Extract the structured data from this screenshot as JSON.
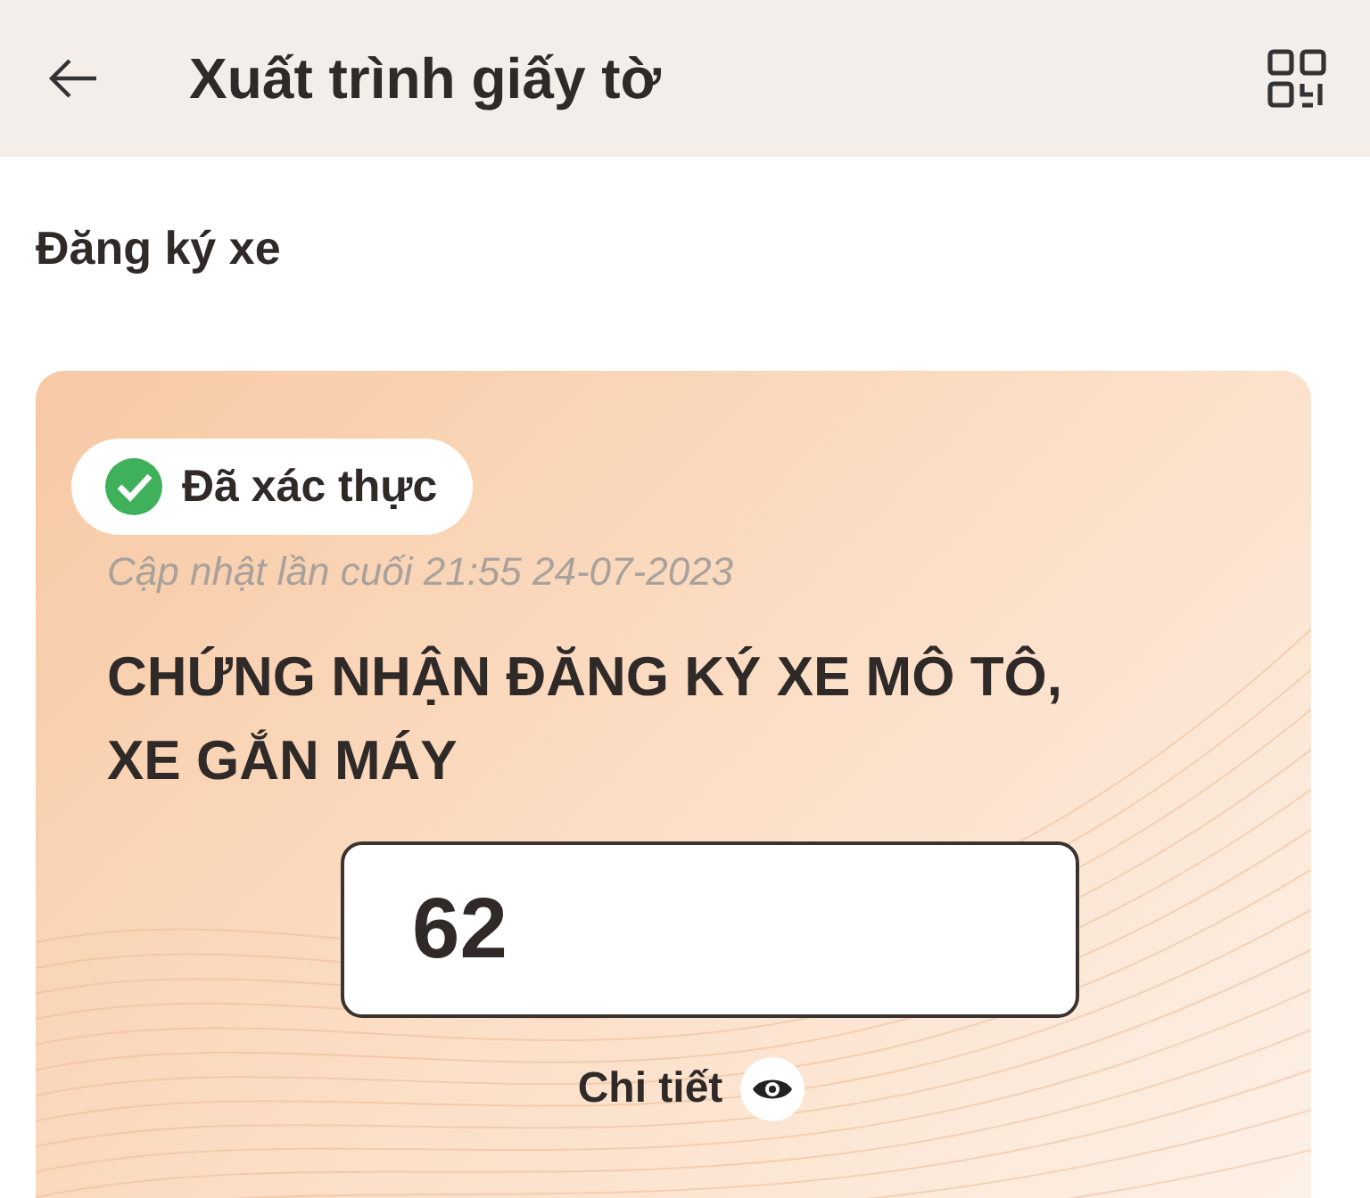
{
  "header": {
    "title": "Xuất trình giấy tờ"
  },
  "section": {
    "title": "Đăng ký xe"
  },
  "card": {
    "status": {
      "label": "Đã xác thực",
      "verified": true
    },
    "updated": "Cập nhật lần cuối 21:55 24-07-2023",
    "title": "CHỨNG NHẬN ĐĂNG KÝ XE MÔ TÔ, XE GẮN MÁY",
    "plate": "62",
    "details_link": "Chi tiết"
  }
}
